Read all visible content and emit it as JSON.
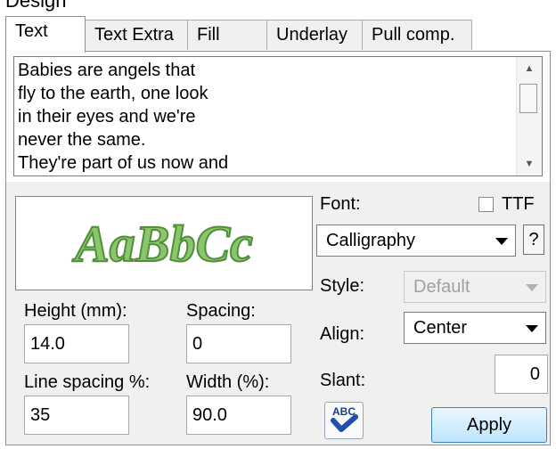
{
  "partial_top_text": "Design",
  "tabs": [
    {
      "label": "Text",
      "active": true
    },
    {
      "label": "Text Extra",
      "active": false
    },
    {
      "label": "Fill",
      "active": false
    },
    {
      "label": "Underlay",
      "active": false
    },
    {
      "label": "Pull comp.",
      "active": false
    }
  ],
  "text_content": {
    "lines": [
      "Babies are angels that",
      "fly to the earth, one look",
      "in their eyes and we're",
      "never the same.",
      "They're part of us now and"
    ]
  },
  "preview": {
    "sample_text": "AaBbCc",
    "fill_color": "#8cc66c",
    "stroke_color": "#4f8f3a"
  },
  "height": {
    "label": "Height (mm):",
    "value": "14.0"
  },
  "spacing": {
    "label": "Spacing:",
    "value": "0"
  },
  "line_spacing": {
    "label": "Line spacing %:",
    "value": "35"
  },
  "width": {
    "label": "Width (%):",
    "value": "90.0"
  },
  "font": {
    "label": "Font:",
    "value": "Calligraphy",
    "help": "?"
  },
  "ttf": {
    "label": "TTF",
    "checked": false
  },
  "style": {
    "label": "Style:",
    "value": "Default",
    "enabled": false
  },
  "align": {
    "label": "Align:",
    "value": "Center"
  },
  "slant": {
    "label": "Slant:",
    "value": "0"
  },
  "spell_check": {
    "icon_text": "ABC",
    "icon": "spell-check-icon"
  },
  "apply_label": "Apply"
}
